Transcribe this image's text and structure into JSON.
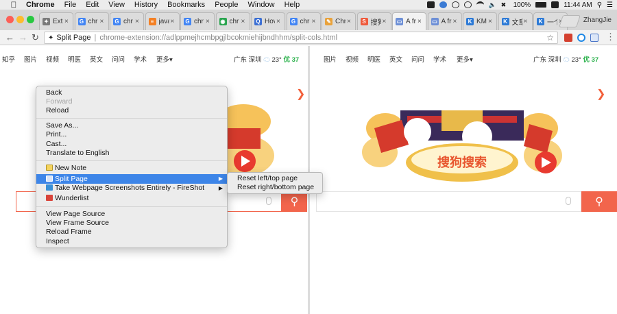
{
  "menubar": {
    "app": "Chrome",
    "items": [
      "File",
      "Edit",
      "View",
      "History",
      "Bookmarks",
      "People",
      "Window",
      "Help"
    ],
    "battery": "100%",
    "clock": "11:44 AM"
  },
  "tabs": [
    {
      "title": "Ext",
      "icon": "puzzle-icon",
      "color": "#7a7a7a",
      "glyph": "✦"
    },
    {
      "title": "chr",
      "icon": "google-icon",
      "color": "#4285f4",
      "glyph": "G"
    },
    {
      "title": "chr",
      "icon": "google-icon",
      "color": "#4285f4",
      "glyph": "G"
    },
    {
      "title": "java",
      "icon": "stackoverflow-icon",
      "color": "#f48024",
      "glyph": "≡"
    },
    {
      "title": "chr",
      "icon": "google-icon",
      "color": "#4285f4",
      "glyph": "G"
    },
    {
      "title": "chr",
      "icon": "chrome-icon",
      "color": "#2aa44f",
      "glyph": "◉"
    },
    {
      "title": "Hov",
      "icon": "search-icon",
      "color": "#3b6fd4",
      "glyph": "Q"
    },
    {
      "title": "chr",
      "icon": "google-icon",
      "color": "#4285f4",
      "glyph": "G"
    },
    {
      "title": "Chr",
      "icon": "pencil-icon",
      "color": "#e9a23b",
      "glyph": "✎"
    },
    {
      "title": "搜狗",
      "icon": "sogou-icon",
      "color": "#ef5a3c",
      "glyph": "S"
    },
    {
      "title": "A fr",
      "icon": "split-page-icon",
      "color": "#6d8fd6",
      "glyph": "▭"
    },
    {
      "title": "A fr",
      "icon": "split-page-icon",
      "color": "#6d8fd6",
      "glyph": "▭"
    },
    {
      "title": "KM",
      "icon": "km-icon",
      "color": "#2d7ad6",
      "glyph": "K"
    },
    {
      "title": "文章",
      "icon": "km-icon",
      "color": "#2d7ad6",
      "glyph": "K"
    },
    {
      "title": "一个",
      "icon": "km-icon",
      "color": "#2d7ad6",
      "glyph": "K"
    }
  ],
  "profile": "ZhangJie",
  "omnibox": {
    "site": "Split Page",
    "url": "chrome-extension://adlppmejhcmbpgjlbcokmiehijbndhhm/split-cols.html"
  },
  "page": {
    "nav": [
      "知乎",
      "图片",
      "视频",
      "明医",
      "英文",
      "问问",
      "学术",
      "更多▾"
    ],
    "city": "广东 深圳",
    "temp": "23°",
    "aqi": "优 37",
    "doodle_text": "搜狗搜索"
  },
  "context_menu": {
    "items": [
      {
        "label": "Back",
        "disabled": false
      },
      {
        "label": "Forward",
        "disabled": true
      },
      {
        "label": "Reload",
        "disabled": false
      },
      {
        "label": "Save As...",
        "disabled": false
      },
      {
        "label": "Print...",
        "disabled": false
      },
      {
        "label": "Cast...",
        "disabled": false
      },
      {
        "label": "Translate to English",
        "disabled": false
      },
      {
        "label": "New Note",
        "disabled": false
      },
      {
        "label": "Split Page",
        "disabled": false
      },
      {
        "label": "Take Webpage Screenshots Entirely - FireShot",
        "disabled": false
      },
      {
        "label": "Wunderlist",
        "disabled": false
      },
      {
        "label": "View Page Source",
        "disabled": false
      },
      {
        "label": "View Frame Source",
        "disabled": false
      },
      {
        "label": "Reload Frame",
        "disabled": false
      },
      {
        "label": "Inspect",
        "disabled": false
      }
    ]
  },
  "submenu": {
    "items": [
      "Reset left/top page",
      "Reset right/bottom page"
    ]
  },
  "colors": {
    "highlight": "#3d85e8",
    "sogou_orange": "#f2654c",
    "aqi_green": "#2bb24c"
  }
}
